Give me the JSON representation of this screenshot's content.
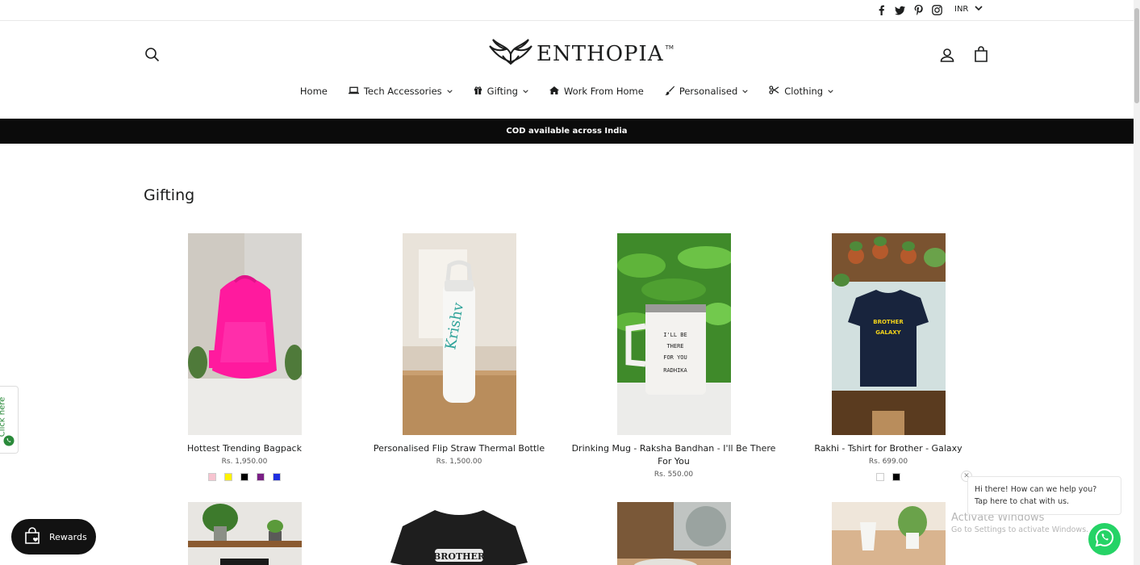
{
  "utility": {
    "social": [
      "facebook-icon",
      "twitter-icon",
      "pinterest-icon",
      "instagram-icon"
    ],
    "currency": "INR"
  },
  "header": {
    "logo_text": "ENTHOPIA",
    "logo_tm": "TM"
  },
  "nav": [
    {
      "label": "Home",
      "icon": "",
      "dropdown": false
    },
    {
      "label": "Tech Accessories",
      "icon": "laptop-icon",
      "dropdown": true
    },
    {
      "label": "Gifting",
      "icon": "gift-icon",
      "dropdown": true
    },
    {
      "label": "Work From Home",
      "icon": "home-icon",
      "dropdown": false
    },
    {
      "label": "Personalised",
      "icon": "brush-icon",
      "dropdown": true
    },
    {
      "label": "Clothing",
      "icon": "scissors-icon",
      "dropdown": true
    }
  ],
  "announcement": "COD available across India",
  "section_title": "Gifting",
  "products": [
    {
      "title": "Hottest Trending Bagpack",
      "price": "Rs. 1,950.00",
      "swatches": [
        "#f7c4d0",
        "#fff200",
        "#000000",
        "#7a1f85",
        "#1f2fe0"
      ]
    },
    {
      "title": "Personalised Flip Straw Thermal Bottle",
      "price": "Rs. 1,500.00",
      "swatches": []
    },
    {
      "title": "Drinking Mug - Raksha Bandhan - I'll Be There For You",
      "price": "Rs. 550.00",
      "swatches": []
    },
    {
      "title": "Rakhi - Tshirt for Brother - Galaxy",
      "price": "Rs. 699.00",
      "swatches": [
        "#ffffff",
        "#000000"
      ]
    }
  ],
  "clicktab": "Click here",
  "rewards": "Rewards",
  "chat": {
    "line1": "Hi there! How can we help you?",
    "line2": "Tap here to chat with us."
  },
  "watermark": {
    "line1": "Activate Windows",
    "line2": "Go to Settings to activate Windows."
  },
  "colors": {
    "announce_bg": "#0b0b0b",
    "whatsapp": "#25d366",
    "rewards_bg": "#121212"
  }
}
